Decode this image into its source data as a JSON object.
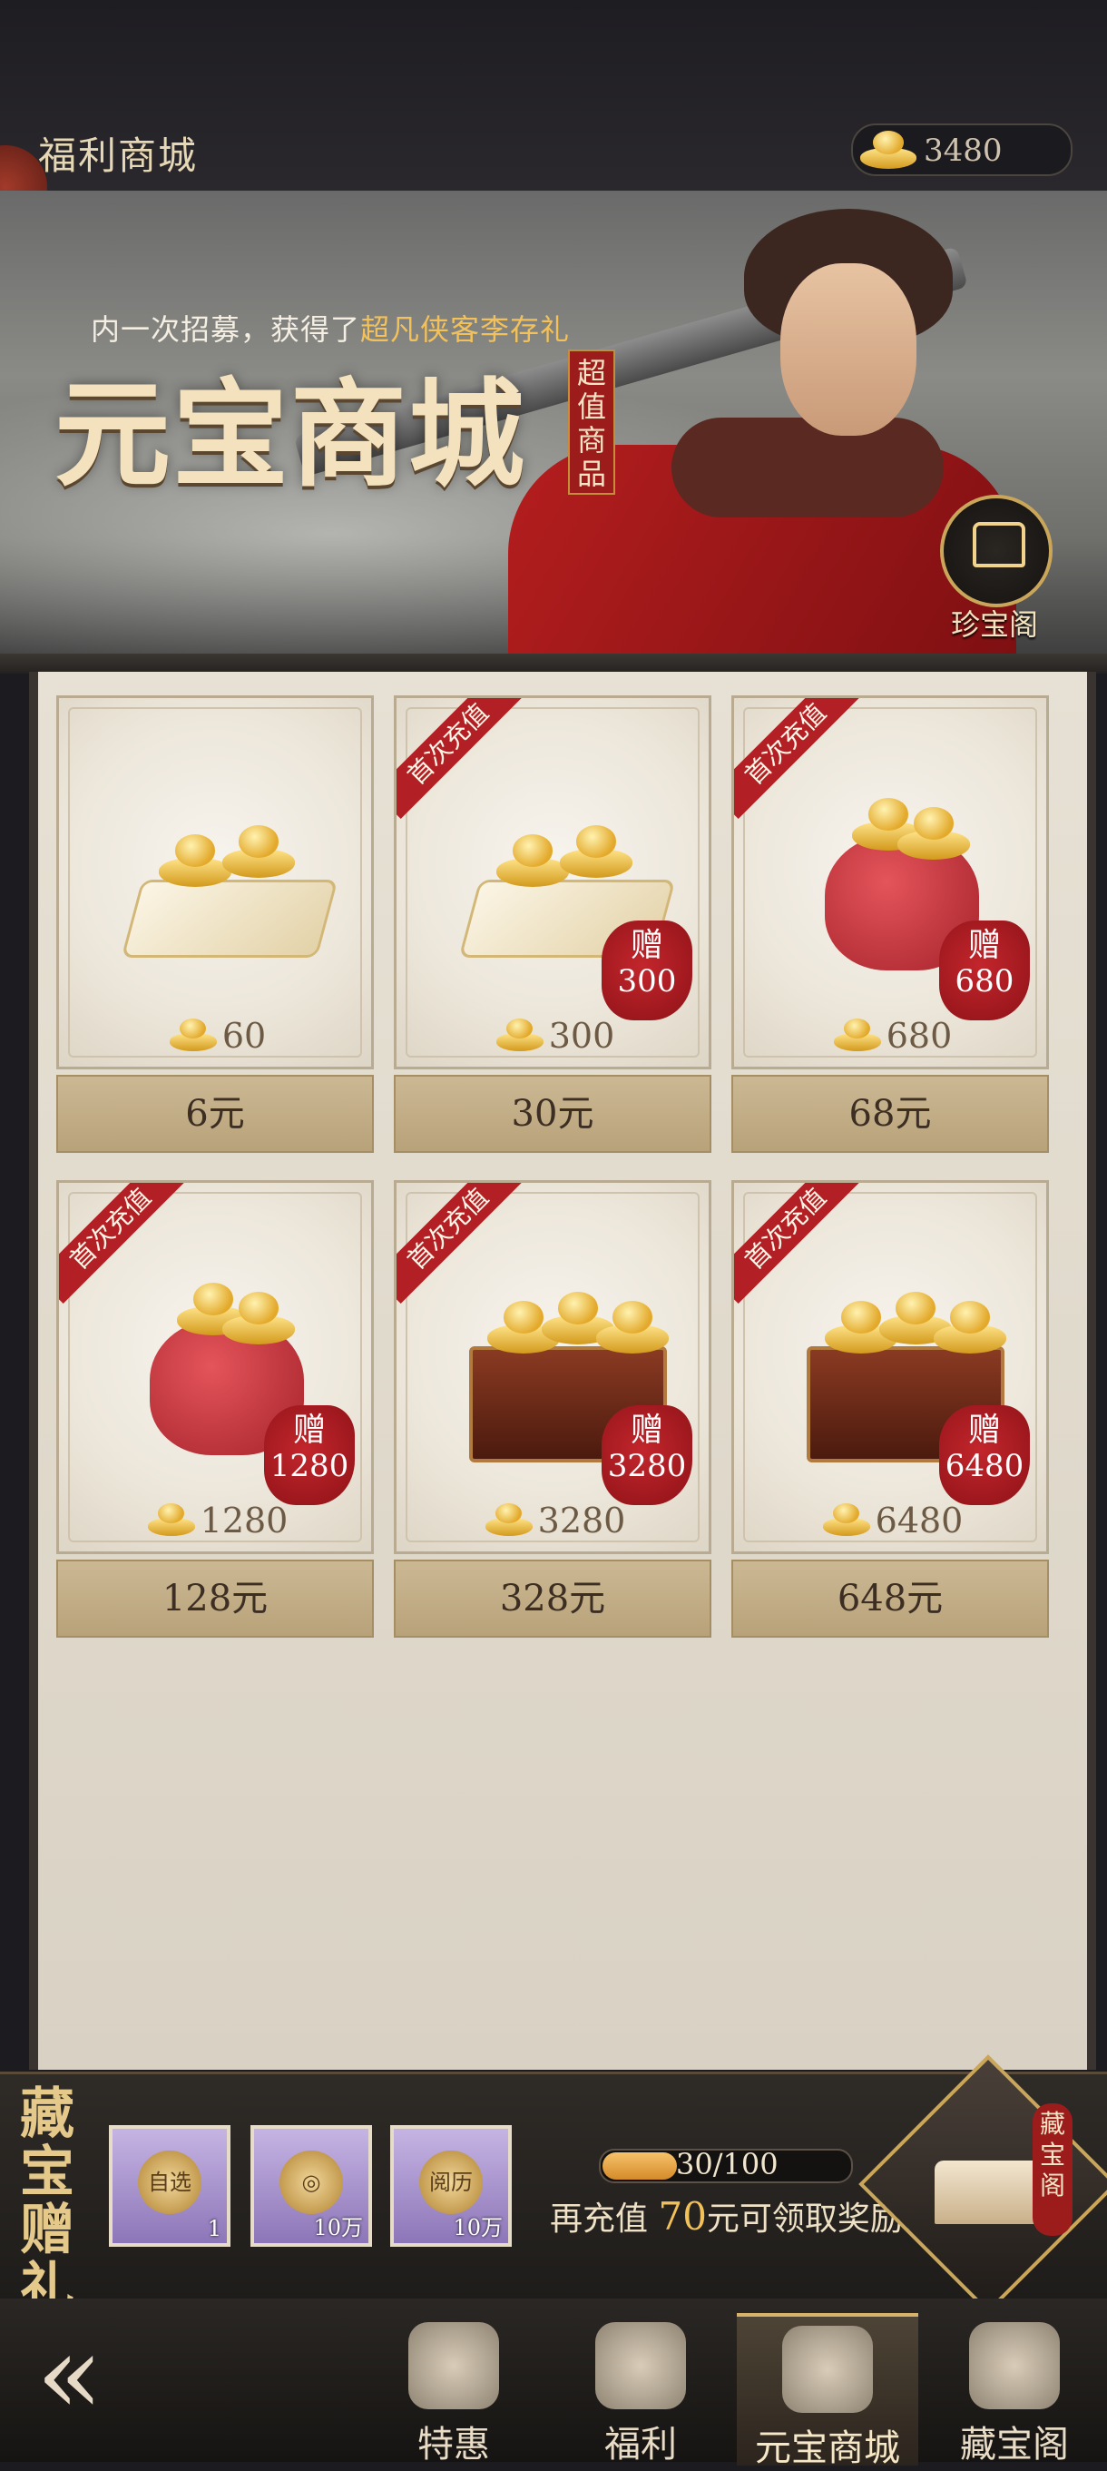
{
  "header": {
    "title": "福利商城",
    "gold_balance": "3480"
  },
  "banner": {
    "ticker_prefix": "内一次招募，获得了",
    "ticker_highlight": "超凡侠客李存礼",
    "title": "元宝商城",
    "tag": "超值商品",
    "treasure_button_label": "珍宝阁"
  },
  "shop": {
    "items": [
      {
        "amount": "60",
        "bonus": "",
        "price": "6元",
        "ribbon": "",
        "art": "plate"
      },
      {
        "amount": "300",
        "bonus": "300",
        "price": "30元",
        "ribbon": "首次充值",
        "art": "plate"
      },
      {
        "amount": "680",
        "bonus": "680",
        "price": "68元",
        "ribbon": "首次充值",
        "art": "bag"
      },
      {
        "amount": "1280",
        "bonus": "1280",
        "price": "128元",
        "ribbon": "首次充值",
        "art": "bag"
      },
      {
        "amount": "3280",
        "bonus": "3280",
        "price": "328元",
        "ribbon": "首次充值",
        "art": "chest"
      },
      {
        "amount": "6480",
        "bonus": "6480",
        "price": "648元",
        "ribbon": "首次充值",
        "art": "chest"
      }
    ],
    "bonus_prefix": "赠"
  },
  "gift": {
    "title": "藏宝赠礼",
    "items": [
      {
        "icon": "自选",
        "count": "1"
      },
      {
        "icon": "",
        "count": "10万"
      },
      {
        "icon": "阅历",
        "count": "10万"
      }
    ],
    "progress_text": "30/100",
    "progress_fraction": 0.3,
    "recharge_prefix": "再充值",
    "recharge_amount": "70",
    "recharge_suffix": "元可领取奖励!",
    "pavilion_tag": "藏宝阁"
  },
  "nav": {
    "tabs": [
      {
        "label": "特惠",
        "active": false
      },
      {
        "label": "福利",
        "active": false
      },
      {
        "label": "元宝商城",
        "active": true
      },
      {
        "label": "藏宝阁",
        "active": false
      }
    ]
  }
}
